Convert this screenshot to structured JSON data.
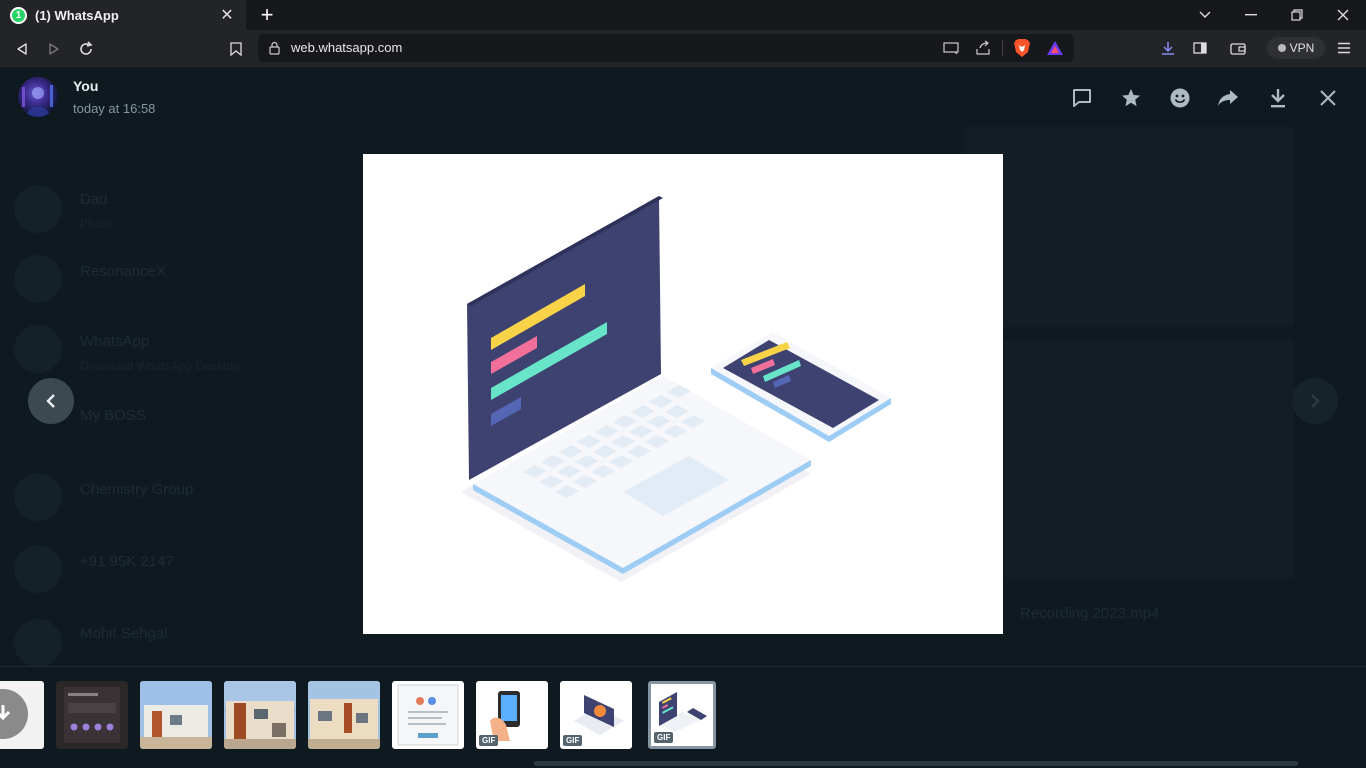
{
  "browser": {
    "tab": {
      "title": "(1) WhatsApp",
      "badge": "1"
    },
    "url": "web.whatsapp.com",
    "vpn_label": "VPN"
  },
  "viewer": {
    "sender": {
      "name": "You",
      "time": "today at 16:58"
    },
    "actions": [
      "reply-icon",
      "star-icon",
      "react-icon",
      "forward-icon",
      "download-icon",
      "close-icon"
    ],
    "gif_badge": "GIF",
    "thumbnails": [
      {
        "label": "download",
        "gif": false,
        "active": false
      },
      {
        "label": "phone-screenshot",
        "gif": false,
        "active": false
      },
      {
        "label": "house-photo-1",
        "gif": false,
        "active": false
      },
      {
        "label": "house-photo-2",
        "gif": false,
        "active": false
      },
      {
        "label": "house-photo-3",
        "gif": false,
        "active": false
      },
      {
        "label": "document-image",
        "gif": false,
        "active": false
      },
      {
        "label": "phone-in-hand",
        "gif": true,
        "active": false
      },
      {
        "label": "laptop-coin",
        "gif": true,
        "active": false
      },
      {
        "label": "laptop-code",
        "gif": true,
        "active": true
      }
    ]
  },
  "background_chats": [
    {
      "name": "Dad",
      "preview": "Photo"
    },
    {
      "name": "ResonanceX",
      "preview": ""
    },
    {
      "name": "WhatsApp",
      "preview": "Download WhatsApp Desktop"
    },
    {
      "name": "My BOSS",
      "preview": ""
    },
    {
      "name": "Chemistry Group",
      "preview": ""
    },
    {
      "name": "+91 95K 2147",
      "preview": ""
    },
    {
      "name": "Mohit Sehgal",
      "preview": ""
    }
  ],
  "background_caption": "Recording 2023.mp4"
}
